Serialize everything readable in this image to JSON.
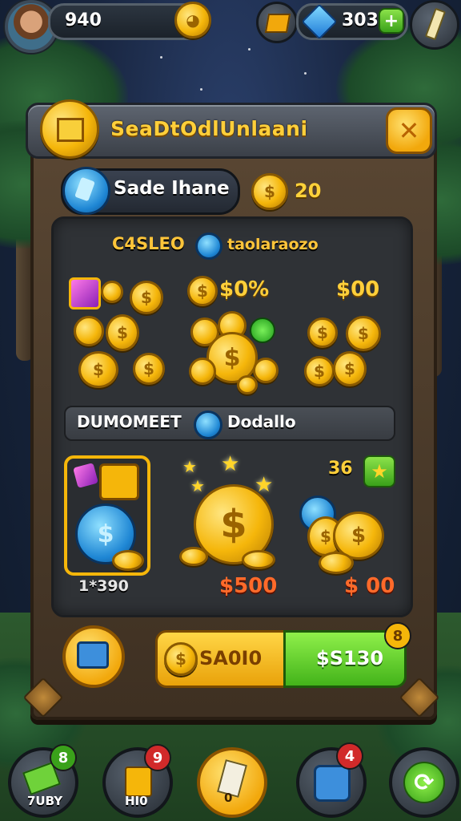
{
  "top_bar": {
    "coins": "940",
    "gems": "303"
  },
  "panel": {
    "title": "SeaDtOdlUnlaani",
    "tab_label": "Sade Ihane",
    "balance": "20"
  },
  "sections": {
    "first": {
      "label_left": "C4SLEO",
      "label_right": "taolaraozo",
      "offer_prices": [
        "$0%",
        "$00"
      ]
    },
    "second": {
      "label_left": "DUMOMEET",
      "label_right": "Dodallo",
      "counter": "36",
      "item_prices": [
        "1*390",
        "$500",
        "$ 00"
      ]
    }
  },
  "actions": {
    "buy_left_label": "SA0I0",
    "buy_right_label": "$S130",
    "buy_badge": "8"
  },
  "bottom_nav": {
    "items": [
      {
        "label": "7UBY",
        "badge": "8",
        "badge_color": "#3aa11a"
      },
      {
        "label": "HI0",
        "badge": "9",
        "badge_color": "#d12a2a"
      },
      {
        "label": "0"
      },
      {
        "badge": "4",
        "badge_color": "#d12a2a"
      },
      {}
    ]
  },
  "colors": {
    "gold": "#f5b60a",
    "green": "#43b31a",
    "blue": "#1e86d4"
  }
}
